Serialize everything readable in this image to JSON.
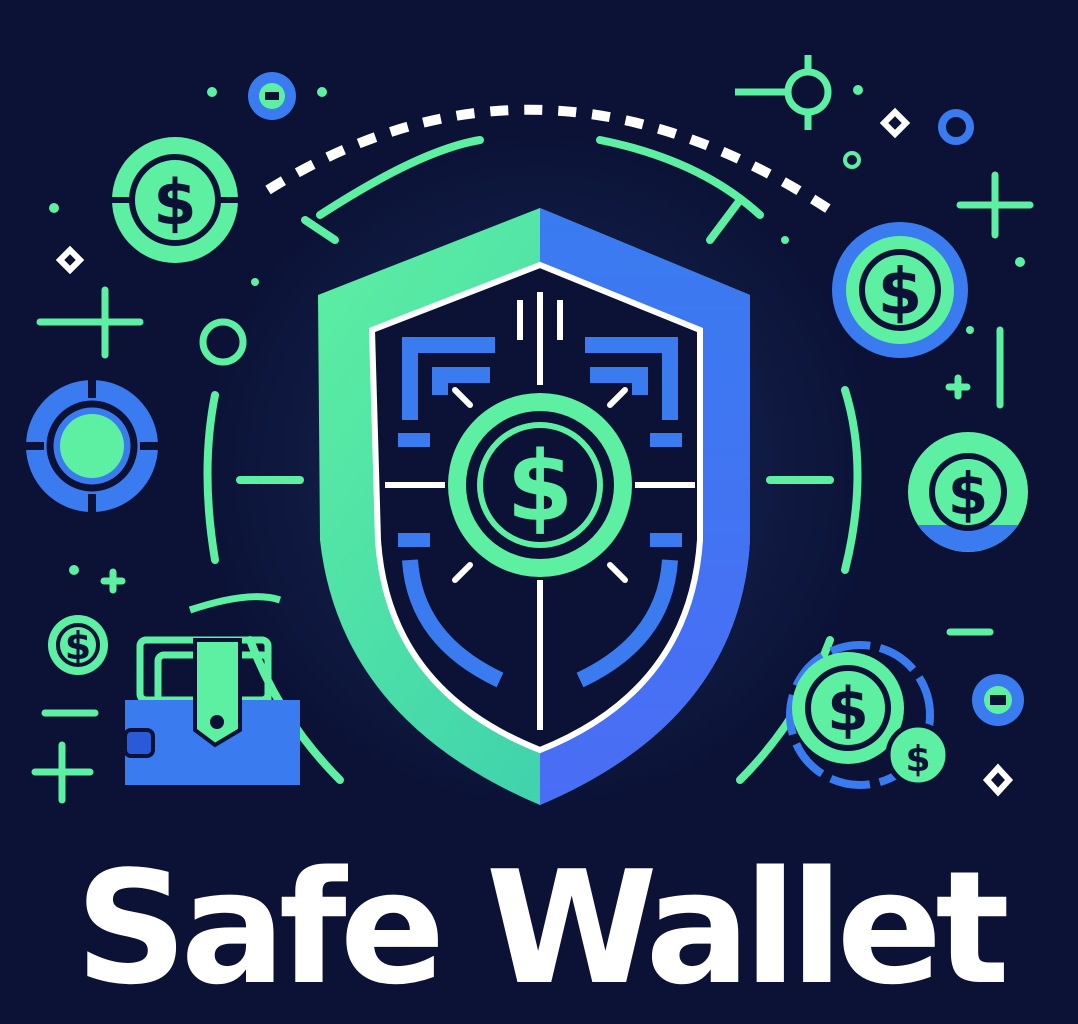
{
  "logo": {
    "wordmark": "Safe Wallet",
    "coin_glyph": "$",
    "colors": {
      "background": "#0b1236",
      "green": "#5ef0a2",
      "blue": "#3a7bf0",
      "white": "#ffffff"
    },
    "icons": [
      "shield-icon",
      "dollar-coin-icon",
      "wallet-icon",
      "crosshair-icon",
      "sparkle-icon"
    ]
  }
}
